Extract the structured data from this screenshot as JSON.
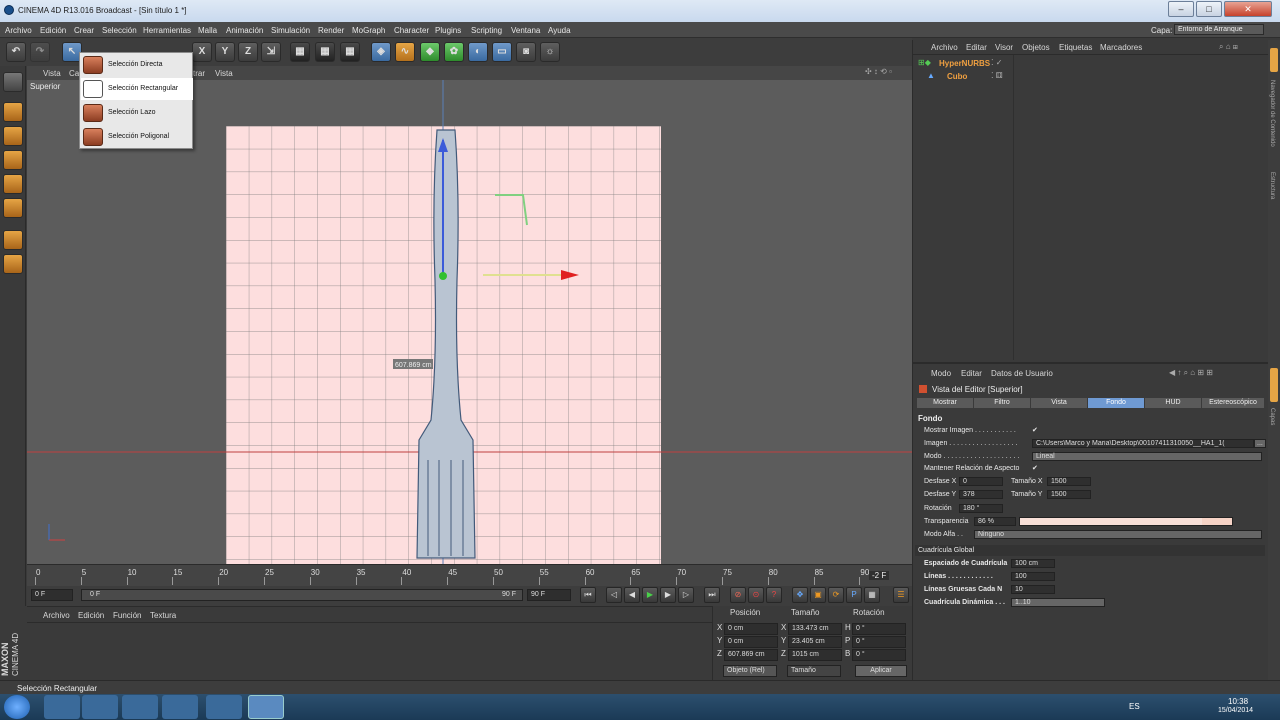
{
  "window": {
    "title": "CINEMA 4D R13.016 Broadcast - [Sin título 1 *]",
    "minimize": "–",
    "maximize": "□",
    "close": "✕"
  },
  "menubar": [
    "Archivo",
    "Edición",
    "Crear",
    "Selección",
    "Herramientas",
    "Malla",
    "Animación",
    "Simulación",
    "Render",
    "MoGraph",
    "Character",
    "Plugins",
    "Scripting",
    "Ventana",
    "Ayuda"
  ],
  "layout": {
    "label": "Capa:",
    "value": "Entorno de Arranque"
  },
  "toolbar": {
    "x_label": "X",
    "y_label": "Y",
    "z_label": "Z"
  },
  "viewport": {
    "menu": [
      "Vista",
      "Ca",
      "trar",
      "Vista"
    ],
    "name": "Superior",
    "measure": "607.869 cm"
  },
  "dropdown": {
    "items": [
      "Selección Directa",
      "Selección Rectangular",
      "Selección Lazo",
      "Selección Poligonal"
    ],
    "highlighted": 1
  },
  "timeline": {
    "ticks": [
      "0",
      "5",
      "10",
      "15",
      "20",
      "25",
      "30",
      "35",
      "40",
      "45",
      "50",
      "55",
      "60",
      "65",
      "70",
      "75",
      "80",
      "85",
      "90"
    ],
    "current": "-2 F"
  },
  "transport": {
    "start_field": "0 F",
    "slider_start": "0 F",
    "slider_end": "90 F",
    "end_field": "90 F"
  },
  "material_manager": {
    "menu": [
      "Archivo",
      "Edición",
      "Función",
      "Textura"
    ]
  },
  "brand": {
    "line1": "MAXON",
    "line2": "CINEMA 4D"
  },
  "coordinates": {
    "headers": [
      "Posición",
      "Tamaño",
      "Rotación"
    ],
    "rows": [
      {
        "axis": "X",
        "pos": "0 cm",
        "size_axis": "X",
        "size": "133.473 cm",
        "rot_axis": "H",
        "rot": "0 °"
      },
      {
        "axis": "Y",
        "pos": "0 cm",
        "size_axis": "Y",
        "size": "23.405 cm",
        "rot_axis": "P",
        "rot": "0 °"
      },
      {
        "axis": "Z",
        "pos": "607.869 cm",
        "size_axis": "Z",
        "size": "1015 cm",
        "rot_axis": "B",
        "rot": "0 °"
      }
    ],
    "mode": "Objeto (Rel)",
    "size_mode": "Tamaño",
    "apply": "Aplicar"
  },
  "object_manager": {
    "menu": [
      "Archivo",
      "Editar",
      "Visor",
      "Objetos",
      "Etiquetas",
      "Marcadores"
    ],
    "objects": [
      {
        "name": "HyperNURBS",
        "color": "#f0a040"
      },
      {
        "name": "Cubo",
        "color": "#f0a040"
      }
    ]
  },
  "side_tabs": [
    "Navegador de Contenido",
    "Estructura",
    "Capas"
  ],
  "attributes": {
    "menu": [
      "Modo",
      "Editar",
      "Datos de Usuario"
    ],
    "title": "Vista del Editor [Superior]",
    "tabs": [
      "Mostrar",
      "Filtro",
      "Vista",
      "Fondo",
      "HUD",
      "Estereoscópico"
    ],
    "active_tab": 3,
    "section": "Fondo",
    "show_image": {
      "label": "Mostrar Imagen . . . . . . . . . . .",
      "value": "✔"
    },
    "image": {
      "label": "Imagen . . . . . . . . . . . . . . . . . .",
      "value": "C:\\Users\\Marco y Maria\\Desktop\\00107411310050__HA1_1(",
      "button": "..."
    },
    "mode": {
      "label": "Modo . . . . . . . . . . . . . . . . . . . .",
      "value": "Lineal"
    },
    "keep_ratio": {
      "label": "Mantener Relación de Aspecto",
      "value": "✔"
    },
    "offset_x": {
      "label": "Desfase X",
      "value": "0"
    },
    "size_x": {
      "label": "Tamaño X",
      "value": "1500"
    },
    "offset_y": {
      "label": "Desfase Y",
      "value": "378"
    },
    "size_y": {
      "label": "Tamaño Y",
      "value": "1500"
    },
    "rotation": {
      "label": "Rotación",
      "value": "180 °"
    },
    "transparency": {
      "label": "Transparencia",
      "value": "86 %",
      "fraction": 0.86
    },
    "alpha": {
      "label": "Modo Alfa . .",
      "value": "Ninguno"
    },
    "grid_section": "Cuadrícula Global",
    "grid_spacing": {
      "label": "Espaciado de Cuadrícula",
      "value": "100 cm"
    },
    "lines": {
      "label": "Líneas . . . . . . . . . . . .",
      "value": "100"
    },
    "thick_lines": {
      "label": "Líneas Gruesas Cada N",
      "value": "10"
    },
    "dynamic_grid": {
      "label": "Cuadrícula Dinámica . . .",
      "value": "1..10"
    }
  },
  "status": "Selección Rectangular",
  "taskbar": {
    "lang": "ES",
    "time": "10:38",
    "date": "15/04/2014"
  },
  "colors": {
    "accent": "#6f9ad3",
    "bg_image": "#fddede",
    "ground_line": "#c04040"
  }
}
